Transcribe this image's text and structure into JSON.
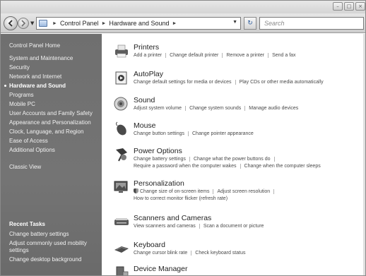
{
  "window": {
    "caption_minimize": "–",
    "caption_maximize": "□",
    "caption_close": "×"
  },
  "address": {
    "crumbs": [
      "Control Panel",
      "Hardware and Sound"
    ],
    "search_placeholder": "Search"
  },
  "sidebar": {
    "items": [
      {
        "label": "Control Panel Home"
      },
      {
        "label": "System and Maintenance"
      },
      {
        "label": "Security"
      },
      {
        "label": "Network and Internet"
      },
      {
        "label": "Hardware and Sound"
      },
      {
        "label": "Programs"
      },
      {
        "label": "Mobile PC"
      },
      {
        "label": "User Accounts and Family Safety"
      },
      {
        "label": "Appearance and Personalization"
      },
      {
        "label": "Clock, Language, and Region"
      },
      {
        "label": "Ease of Access"
      },
      {
        "label": "Additional Options"
      },
      {
        "label": "Classic View"
      }
    ],
    "recent_title": "Recent Tasks",
    "recent_items": [
      {
        "label": "Change battery settings"
      },
      {
        "label": "Adjust commonly used mobility settings"
      },
      {
        "label": "Change desktop background"
      }
    ]
  },
  "categories": [
    {
      "title": "Printers",
      "icon": "printer-icon",
      "links": [
        "Add a printer",
        "Change default printer",
        "Remove a printer",
        "Send a fax"
      ]
    },
    {
      "title": "AutoPlay",
      "icon": "autoplay-icon",
      "links": [
        "Change default settings for media or devices",
        "Play CDs or other media automatically"
      ]
    },
    {
      "title": "Sound",
      "icon": "sound-icon",
      "links": [
        "Adjust system volume",
        "Change system sounds",
        "Manage audio devices"
      ]
    },
    {
      "title": "Mouse",
      "icon": "mouse-icon",
      "links": [
        "Change button settings",
        "Change pointer appearance"
      ]
    },
    {
      "title": "Power Options",
      "icon": "power-options-icon",
      "links_line1": [
        "Change battery settings",
        "Change what the power buttons do"
      ],
      "links_line2": [
        "Require a password when the computer wakes",
        "Change when the computer sleeps"
      ]
    },
    {
      "title": "Personalization",
      "icon": "personalization-icon",
      "links_line1": [
        "Change size of on-screen items",
        "Adjust screen resolution"
      ],
      "links_line2": [
        "How to correct monitor flicker (refresh rate)"
      ]
    },
    {
      "title": "Scanners and Cameras",
      "icon": "scanner-icon",
      "links": [
        "View scanners and cameras",
        "Scan a document or picture"
      ]
    },
    {
      "title": "Keyboard",
      "icon": "keyboard-icon",
      "links": [
        "Change cursor blink rate",
        "Check keyboard status"
      ]
    },
    {
      "title": "Device Manager",
      "icon": "device-manager-icon",
      "links": []
    }
  ]
}
